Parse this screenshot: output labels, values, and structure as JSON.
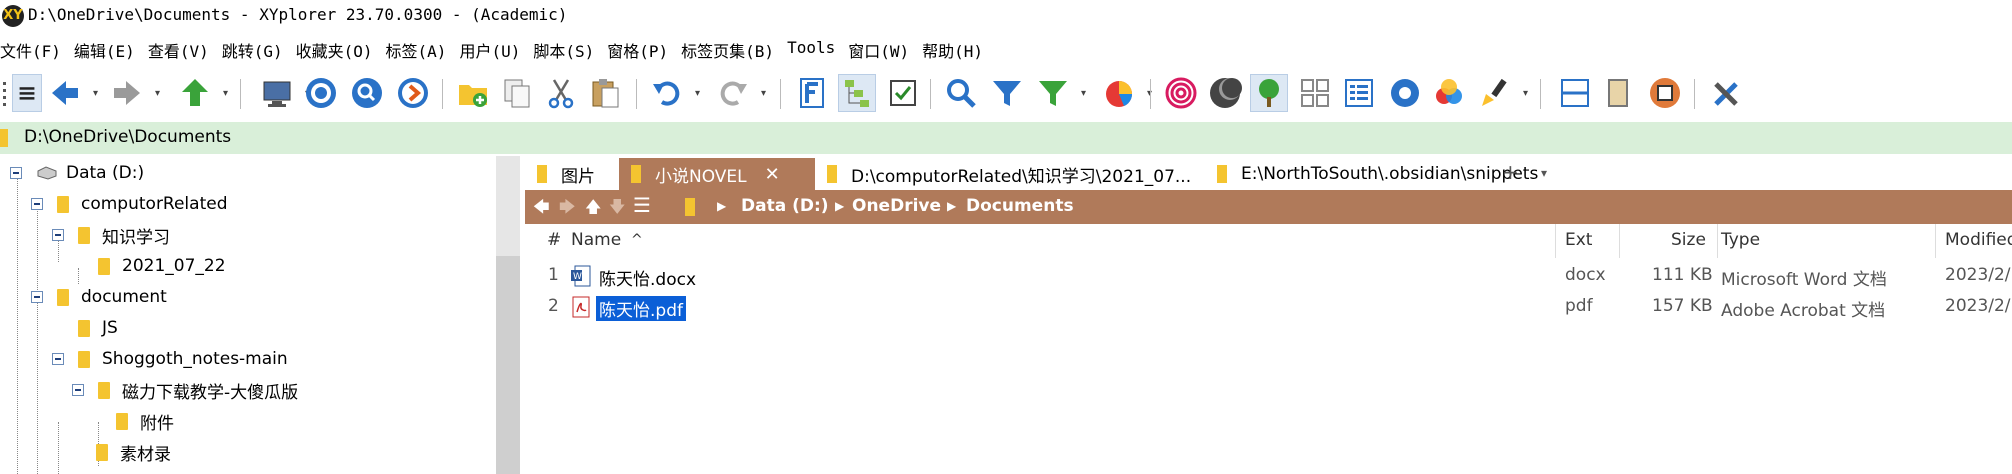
{
  "window": {
    "title": "D:\\OneDrive\\Documents - XYplorer 23.70.0300 - (Academic)",
    "app_icon_text": "XY"
  },
  "menu": [
    "文件(F)",
    "编辑(E)",
    "查看(V)",
    "跳转(G)",
    "收藏夹(O)",
    "标签(A)",
    "用户(U)",
    "脚本(S)",
    "窗格(P)",
    "标签页集(B)",
    "Tools",
    "窗口(W)",
    "帮助(H)"
  ],
  "toolbar": {
    "icons": [
      "menu-icon",
      "back-icon",
      "forward-icon",
      "up-icon",
      "computer-icon",
      "target-icon",
      "search-circle-icon",
      "next-circle-icon",
      "new-folder-icon",
      "copy-icon",
      "cut-icon",
      "paste-icon",
      "undo-icon",
      "redo-icon",
      "find-files-icon",
      "tree-toggle-icon",
      "checkbox-icon",
      "find-icon",
      "filter-icon",
      "visual-filter-icon",
      "pie-icon",
      "spiral-icon",
      "dark-mode-icon",
      "tree-icon",
      "grid-view-icon",
      "details-view-icon",
      "settings-gear-icon",
      "color-filter-icon",
      "brush-icon",
      "horizontal-split-icon",
      "vertical-split-icon",
      "box-icon",
      "tools-icon"
    ]
  },
  "address": {
    "path": "D:\\OneDrive\\Documents"
  },
  "tree": {
    "items": [
      {
        "label": "Data (D:)",
        "level": 0,
        "type": "drive"
      },
      {
        "label": "computorRelated",
        "level": 1,
        "type": "folder",
        "expandable": true
      },
      {
        "label": "知识学习",
        "level": 2,
        "type": "folder",
        "expandable": true
      },
      {
        "label": "2021_07_22",
        "level": 3,
        "type": "folder",
        "expandable": false
      },
      {
        "label": "document",
        "level": 1,
        "type": "folder",
        "expandable": true
      },
      {
        "label": "JS",
        "level": 2,
        "type": "folder",
        "expandable": false
      },
      {
        "label": "Shoggoth_notes-main",
        "level": 2,
        "type": "folder",
        "expandable": true
      },
      {
        "label": "磁力下载教学-大傻瓜版",
        "level": 3,
        "type": "folder",
        "expandable": true
      },
      {
        "label": "附件",
        "level": 4,
        "type": "folder",
        "expandable": false
      },
      {
        "label": "素材录",
        "level": 3,
        "type": "folder",
        "expandable": false
      }
    ]
  },
  "tabs": [
    {
      "label": "图片",
      "active": false
    },
    {
      "label": "小说NOVEL",
      "active": true,
      "close": "✕"
    },
    {
      "label": "D:\\computorRelated\\知识学习\\2021_07...",
      "active": false
    },
    {
      "label": "E:\\NorthToSouth\\.obsidian\\snippets",
      "active": false
    }
  ],
  "tab_add": "+",
  "tab_dropdown": "▾",
  "breadcrumb": {
    "segments": [
      "Data (D:)",
      "OneDrive",
      "Documents"
    ]
  },
  "list": {
    "columns": {
      "num": "#",
      "name": "Name",
      "sort_indicator": "^",
      "ext": "Ext",
      "size": "Size",
      "type": "Type",
      "modified": "Modified"
    },
    "rows": [
      {
        "num": "1",
        "name": "陈天怡.docx",
        "ext": "docx",
        "size": "111 KB",
        "type": "Microsoft Word 文档",
        "modified": "2023/2/",
        "icon": "word-doc-icon",
        "selected": false
      },
      {
        "num": "2",
        "name": "陈天怡.pdf",
        "ext": "pdf",
        "size": "157 KB",
        "type": "Adobe Acrobat 文档",
        "modified": "2023/2/",
        "icon": "pdf-icon",
        "selected": true
      }
    ]
  },
  "colors": {
    "accent": "#b07a5a",
    "address_bg": "#d9efd9",
    "selection": "#0b5fd7",
    "folder": "#f4c430"
  }
}
